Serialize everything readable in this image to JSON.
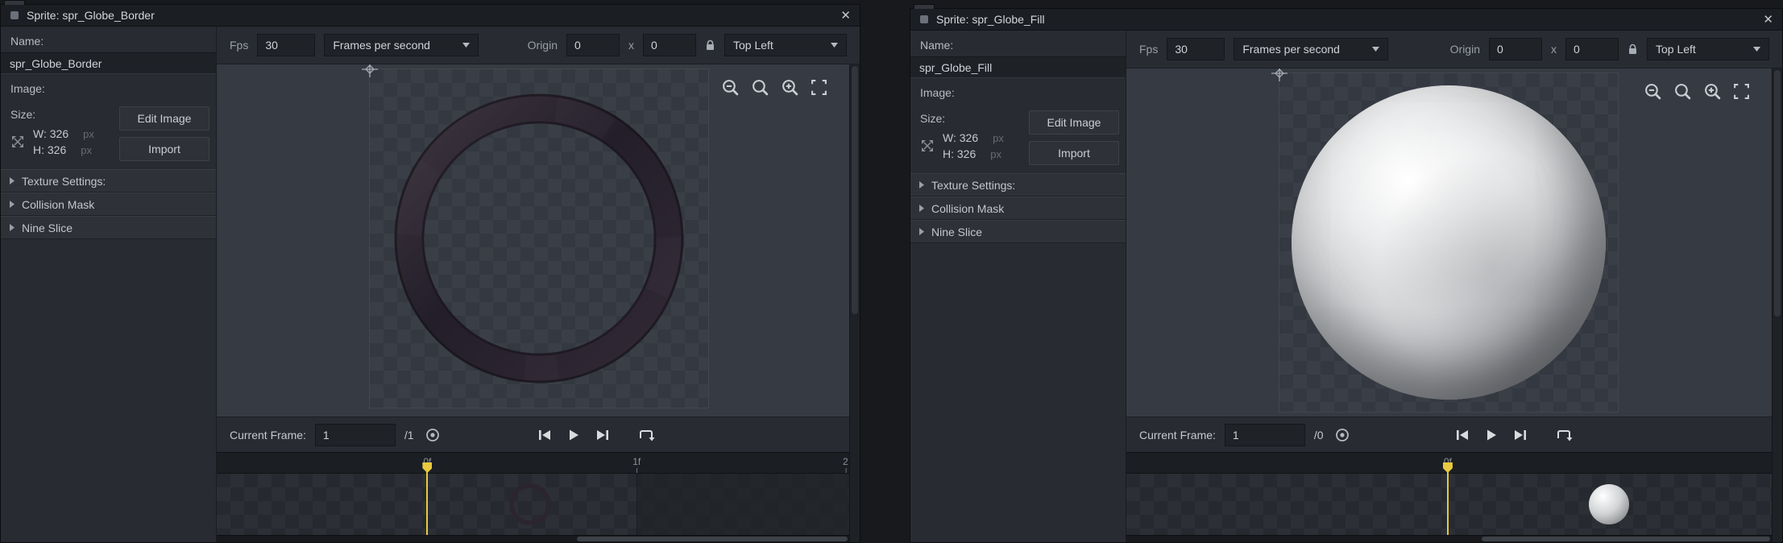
{
  "windows": [
    {
      "title": "Sprite: spr_Globe_Border",
      "close_glyph": "✕",
      "panel": {
        "name_label": "Name:",
        "name_value": "spr_Globe_Border",
        "image_label": "Image:",
        "size_label": "Size:",
        "width_label": "W: 326",
        "height_label": "H: 326",
        "px_unit": "px",
        "edit_image_button": "Edit Image",
        "import_button": "Import",
        "sections": [
          {
            "label": "Texture Settings:"
          },
          {
            "label": "Collision Mask"
          },
          {
            "label": "Nine Slice"
          }
        ]
      },
      "toolbar": {
        "fps_label": "Fps",
        "fps_value": "30",
        "fps_mode": "Frames per second",
        "origin_label": "Origin",
        "origin_x_value": "0",
        "x_label": "x",
        "origin_y_value": "0",
        "origin_preset": "Top Left"
      },
      "playback": {
        "current_frame_label": "Current Frame:",
        "current_frame_value": "1",
        "frame_total": "/1"
      },
      "timeline": {
        "ticks": [
          {
            "label": "0f"
          },
          {
            "label": "1f"
          },
          {
            "label": "2"
          }
        ]
      }
    },
    {
      "title": "Sprite: spr_Globe_Fill",
      "close_glyph": "✕",
      "panel": {
        "name_label": "Name:",
        "name_value": "spr_Globe_Fill",
        "image_label": "Image:",
        "size_label": "Size:",
        "width_label": "W: 326",
        "height_label": "H: 326",
        "px_unit": "px",
        "edit_image_button": "Edit Image",
        "import_button": "Import",
        "sections": [
          {
            "label": "Texture Settings:"
          },
          {
            "label": "Collision Mask"
          },
          {
            "label": "Nine Slice"
          }
        ]
      },
      "toolbar": {
        "fps_label": "Fps",
        "fps_value": "30",
        "fps_mode": "Frames per second",
        "origin_label": "Origin",
        "origin_x_value": "0",
        "x_label": "x",
        "origin_y_value": "0",
        "origin_preset": "Top Left"
      },
      "playback": {
        "current_frame_label": "Current Frame:",
        "current_frame_value": "1",
        "frame_total": "/0"
      },
      "timeline": {
        "ticks": [
          {
            "label": "0f"
          }
        ]
      }
    }
  ],
  "colors": {
    "playhead": "#e8c93f",
    "window_bg": "#282b31",
    "canvas_bg": "#363a42"
  }
}
